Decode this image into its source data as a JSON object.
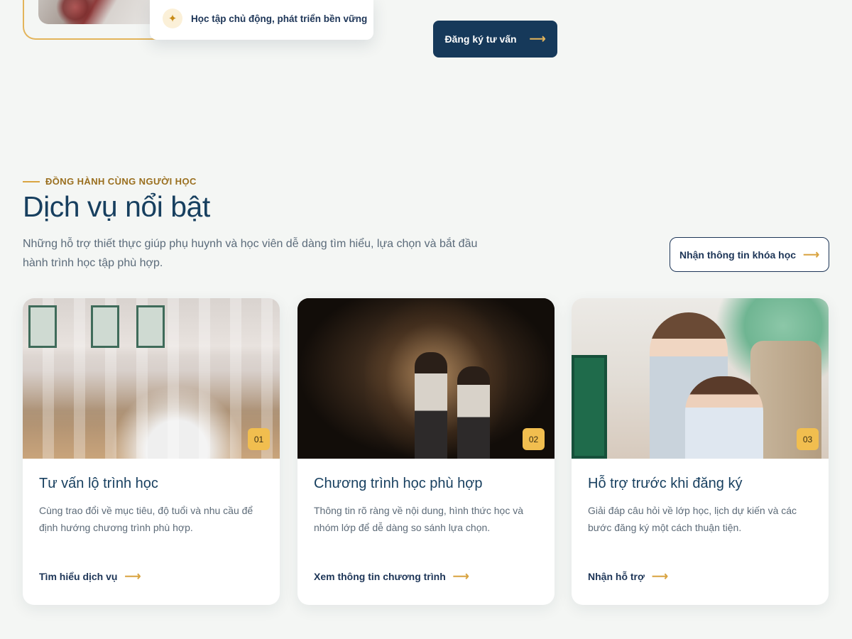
{
  "hero": {
    "badge_icon": "sparkle-icon",
    "badge_text": "Học tập chủ động, phát triển bền vững",
    "consult_button": "Đăng ký tư vấn",
    "arrow": "⟶"
  },
  "section": {
    "eyebrow": "ĐỒNG HÀNH CÙNG NGƯỜI HỌC",
    "title": "Dịch vụ nổi bật",
    "description": "Những hỗ trợ thiết thực giúp phụ huynh và học viên dễ dàng tìm hiểu, lựa chọn và bắt đầu hành trình học tập phù hợp.",
    "info_button": "Nhận thông tin khóa học"
  },
  "cards": [
    {
      "number": "01",
      "title": "Tư vấn lộ trình học",
      "text": "Cùng trao đổi về mục tiêu, độ tuổi và nhu cầu để định hướng chương trình phù hợp.",
      "link": "Tìm hiểu dịch vụ"
    },
    {
      "number": "02",
      "title": "Chương trình học phù hợp",
      "text": "Thông tin rõ ràng về nội dung, hình thức học và nhóm lớp để dễ dàng so sánh lựa chọn.",
      "link": "Xem thông tin chương trình"
    },
    {
      "number": "03",
      "title": "Hỗ trợ trước khi đăng ký",
      "text": "Giải đáp câu hỏi về lớp học, lịch dự kiến và các bước đăng ký một cách thuận tiện.",
      "link": "Nhận hỗ trợ"
    }
  ],
  "colors": {
    "primary": "#16395a",
    "accent": "#e3b45b",
    "badge": "#f1be4f",
    "background": "#f4f6f4"
  }
}
